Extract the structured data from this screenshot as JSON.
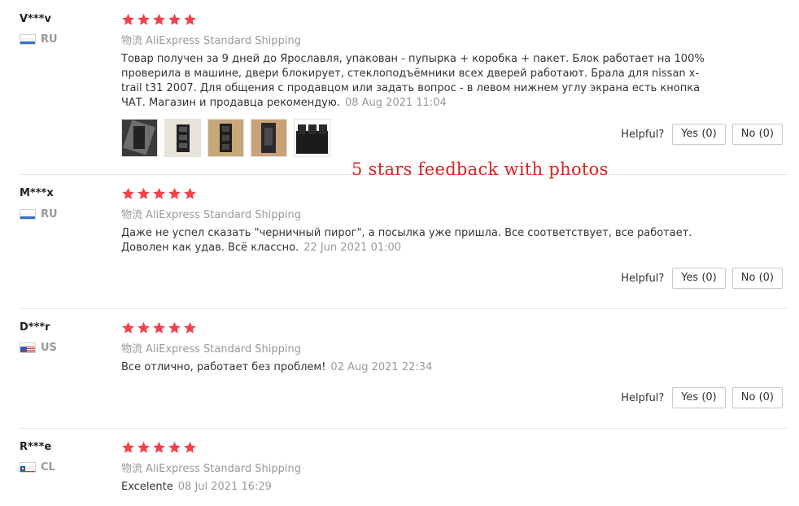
{
  "overlay_caption": "5 stars feedback with photos",
  "accent_star_color": "#f5414a",
  "reviews": [
    {
      "user": "V***v",
      "country": "RU",
      "stars": 5,
      "shipping_label": "物流",
      "shipping_method": "AliExpress Standard Shipping",
      "text": "Товар получен за 9 дней до Ярославля, упакован - пупырка + коробка + пакет. Блок работает на 100% проверила в машине, двери блокирует, стеклоподъёмники всех дверей работают. Брала для nissan x-trail t31 2007. Для общения с продавцом или задать вопрос - в левом нижнем углу экрана есть кнопка ЧАТ. Магазин и продавца рекомендую.",
      "date": "08 Aug 2021 11:04",
      "photo_count": 5,
      "helpful_label": "Helpful?",
      "yes_label": "Yes (0)",
      "no_label": "No (0)"
    },
    {
      "user": "M***x",
      "country": "RU",
      "stars": 5,
      "shipping_label": "物流",
      "shipping_method": "AliExpress Standard Shipping",
      "text": "Даже не успел сказать \"черничный пирог\", а посылка уже пришла. Все соответствует, все работает. Доволен как удав. Всё классно.",
      "date": "22 Jun 2021 01:00",
      "helpful_label": "Helpful?",
      "yes_label": "Yes (0)",
      "no_label": "No (0)"
    },
    {
      "user": "D***r",
      "country": "US",
      "stars": 5,
      "shipping_label": "物流",
      "shipping_method": "AliExpress Standard Shipping",
      "text": "Все отлично, работает без проблем!",
      "date": "02 Aug 2021 22:34",
      "helpful_label": "Helpful?",
      "yes_label": "Yes (0)",
      "no_label": "No (0)"
    },
    {
      "user": "R***e",
      "country": "CL",
      "stars": 5,
      "shipping_label": "物流",
      "shipping_method": "AliExpress Standard Shipping",
      "text": "Excelente",
      "date": "08 Jul 2021 16:29"
    }
  ]
}
